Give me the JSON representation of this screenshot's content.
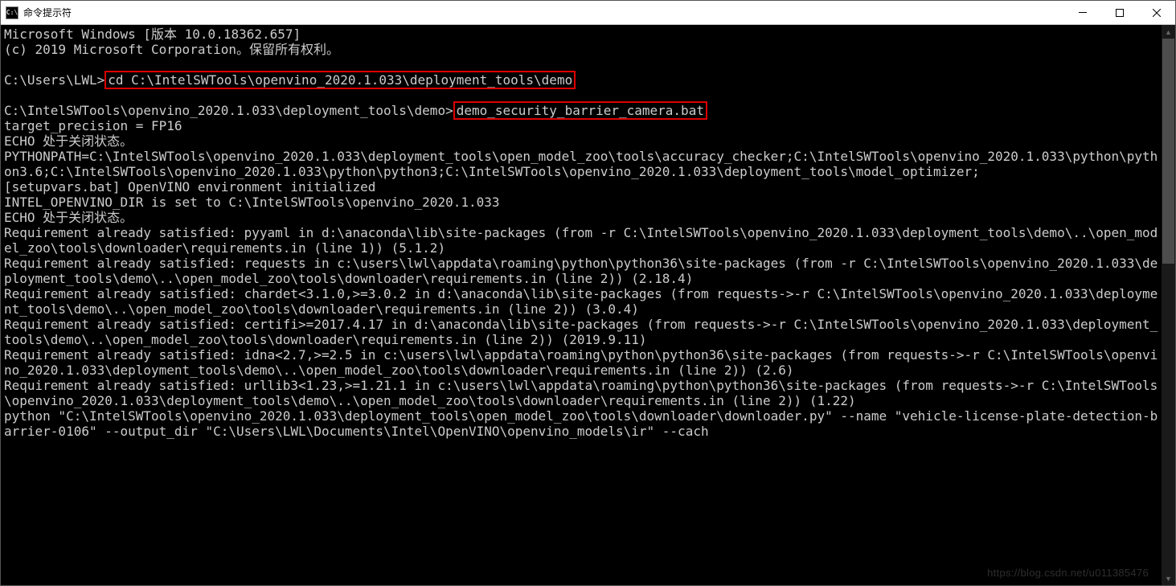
{
  "window": {
    "title": "命令提示符",
    "icon_text": "C:\\"
  },
  "terminal": {
    "header_line1": "Microsoft Windows [版本 10.0.18362.657]",
    "header_line2": "(c) 2019 Microsoft Corporation。保留所有权利。",
    "prompt1_prefix": "C:\\Users\\LWL>",
    "prompt1_cmd": "cd C:\\IntelSWTools\\openvino_2020.1.033\\deployment_tools\\demo",
    "prompt2_prefix": "C:\\IntelSWTools\\openvino_2020.1.033\\deployment_tools\\demo>",
    "prompt2_cmd": "demo_security_barrier_camera.bat",
    "out_target_precision": "target_precision = FP16",
    "out_echo1": "ECHO 处于关闭状态。",
    "out_pythonpath": "PYTHONPATH=C:\\IntelSWTools\\openvino_2020.1.033\\deployment_tools\\open_model_zoo\\tools\\accuracy_checker;C:\\IntelSWTools\\openvino_2020.1.033\\python\\python3.6;C:\\IntelSWTools\\openvino_2020.1.033\\python\\python3;C:\\IntelSWTools\\openvino_2020.1.033\\deployment_tools\\model_optimizer;",
    "out_setupvars": "[setupvars.bat] OpenVINO environment initialized",
    "out_intel_dir": "INTEL_OPENVINO_DIR is set to C:\\IntelSWTools\\openvino_2020.1.033",
    "out_echo2": "ECHO 处于关闭状态。",
    "out_req_pyyaml": "Requirement already satisfied: pyyaml in d:\\anaconda\\lib\\site-packages (from -r C:\\IntelSWTools\\openvino_2020.1.033\\deployment_tools\\demo\\..\\open_model_zoo\\tools\\downloader\\requirements.in (line 1)) (5.1.2)",
    "out_req_requests": "Requirement already satisfied: requests in c:\\users\\lwl\\appdata\\roaming\\python\\python36\\site-packages (from -r C:\\IntelSWTools\\openvino_2020.1.033\\deployment_tools\\demo\\..\\open_model_zoo\\tools\\downloader\\requirements.in (line 2)) (2.18.4)",
    "out_req_chardet": "Requirement already satisfied: chardet<3.1.0,>=3.0.2 in d:\\anaconda\\lib\\site-packages (from requests->-r C:\\IntelSWTools\\openvino_2020.1.033\\deployment_tools\\demo\\..\\open_model_zoo\\tools\\downloader\\requirements.in (line 2)) (3.0.4)",
    "out_req_certifi": "Requirement already satisfied: certifi>=2017.4.17 in d:\\anaconda\\lib\\site-packages (from requests->-r C:\\IntelSWTools\\openvino_2020.1.033\\deployment_tools\\demo\\..\\open_model_zoo\\tools\\downloader\\requirements.in (line 2)) (2019.9.11)",
    "out_req_idna": "Requirement already satisfied: idna<2.7,>=2.5 in c:\\users\\lwl\\appdata\\roaming\\python\\python36\\site-packages (from requests->-r C:\\IntelSWTools\\openvino_2020.1.033\\deployment_tools\\demo\\..\\open_model_zoo\\tools\\downloader\\requirements.in (line 2)) (2.6)",
    "out_req_urllib3": "Requirement already satisfied: urllib3<1.23,>=1.21.1 in c:\\users\\lwl\\appdata\\roaming\\python\\python36\\site-packages (from requests->-r C:\\IntelSWTools\\openvino_2020.1.033\\deployment_tools\\demo\\..\\open_model_zoo\\tools\\downloader\\requirements.in (line 2)) (1.22)",
    "out_python_cmd": "python \"C:\\IntelSWTools\\openvino_2020.1.033\\deployment_tools\\open_model_zoo\\tools\\downloader\\downloader.py\" --name \"vehicle-license-plate-detection-barrier-0106\" --output_dir \"C:\\Users\\LWL\\Documents\\Intel\\OpenVINO\\openvino_models\\ir\" --cach"
  },
  "watermark": "https://blog.csdn.net/u011385476"
}
